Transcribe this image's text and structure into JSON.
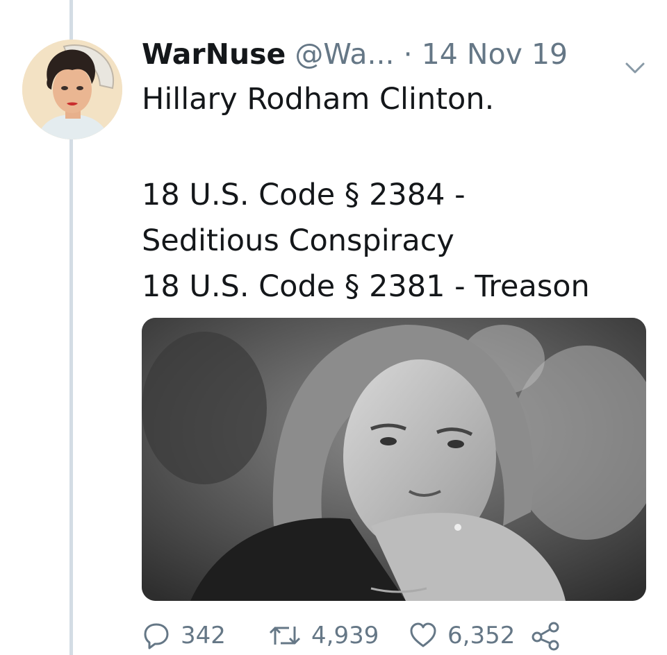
{
  "tweet": {
    "display_name": "WarNuse",
    "handle": "@Wa...",
    "separator": "·",
    "date": "14 Nov 19",
    "text_lines": [
      "Hillary Rodham Clinton.",
      "18 U.S. Code § 2384 -",
      "Seditious Conspiracy",
      "18 U.S. Code § 2381 - Treason"
    ]
  },
  "actions": {
    "reply_icon": "reply-icon",
    "reply_count": "342",
    "retweet_icon": "retweet-icon",
    "retweet_count": "4,939",
    "like_icon": "heart-icon",
    "like_count": "6,352",
    "share_icon": "share-icon"
  },
  "colors": {
    "text": "#14171a",
    "muted": "#657786",
    "thread_line": "#d3dce4"
  }
}
